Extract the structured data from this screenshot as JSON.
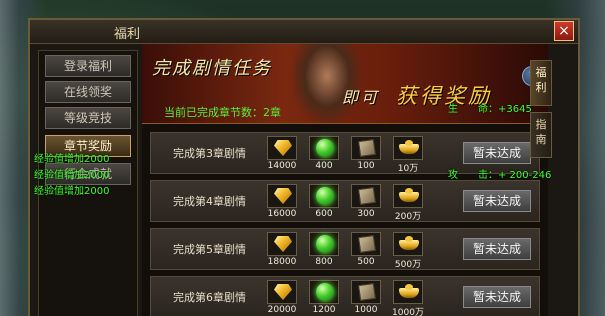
{
  "window": {
    "title": "福利",
    "close_symbol": "×"
  },
  "nav": {
    "items": [
      {
        "label": "登录福利",
        "active": false
      },
      {
        "label": "在线领奖",
        "active": false
      },
      {
        "label": "等级竞技",
        "active": false
      },
      {
        "label": "章节奖励",
        "active": true
      },
      {
        "label": "行会成就",
        "active": false
      }
    ]
  },
  "banner": {
    "title": "完成剧情任务",
    "slogan_a": "即可",
    "slogan_b": "获得奖励",
    "status": "当前已完成章节数：2章",
    "help_symbol": "?"
  },
  "rows": [
    {
      "label": "完成第3章剧情",
      "rewards": [
        "14000",
        "400",
        "100",
        "10万"
      ],
      "status": "暂未达成"
    },
    {
      "label": "完成第4章剧情",
      "rewards": [
        "16000",
        "600",
        "300",
        "200万"
      ],
      "status": "暂未达成"
    },
    {
      "label": "完成第5章剧情",
      "rewards": [
        "18000",
        "800",
        "500",
        "500万"
      ],
      "status": "暂未达成"
    },
    {
      "label": "完成第6章剧情",
      "rewards": [
        "20000",
        "1200",
        "1000",
        "1000万"
      ],
      "status": "暂未达成"
    }
  ],
  "reward_icons": [
    "gold-gem-icon",
    "green-orb-icon",
    "scroll-book-icon",
    "gold-ingot-icon"
  ],
  "side_tabs": [
    {
      "label": "福利",
      "active": true
    },
    {
      "label": "指南",
      "active": false
    }
  ],
  "floating_messages": [
    "经验值增加2000",
    "经验值增加2000",
    "经验值增加2000"
  ],
  "stats": {
    "hp": "生　　命：+3645",
    "attack": "攻　　击：+ 200-246"
  },
  "colors": {
    "accent_green": "#3dff2a",
    "gold_text": "#f6e7a8",
    "frame": "#6b5a3a"
  }
}
